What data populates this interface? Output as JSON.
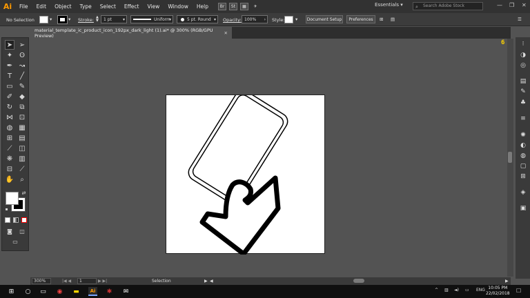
{
  "app": {
    "logo": "Ai",
    "brand_color": "#ff9a00"
  },
  "menu": [
    "File",
    "Edit",
    "Object",
    "Type",
    "Select",
    "Effect",
    "View",
    "Window",
    "Help"
  ],
  "menu_icons": [
    "Br",
    "St",
    "▦",
    "✈"
  ],
  "workspace": "Essentials",
  "stock_search_placeholder": "Search Adobe Stock",
  "window_controls": {
    "minimize": "—",
    "restore": "❐",
    "close": "✕"
  },
  "control_bar": {
    "selection": "No Selection",
    "stroke_label": "Stroke:",
    "stroke_value": "1 pt",
    "profile": "Uniform",
    "brush": "5 pt. Round",
    "opacity_label": "Opacity:",
    "opacity_value": "100%",
    "style_label": "Style:",
    "document_setup": "Document Setup",
    "preferences": "Preferences"
  },
  "document_tab": {
    "title": "material_template_ic_product_icon_192px_dark_light (1).ai* @ 300% (RGB/GPU Preview)",
    "close": "✕"
  },
  "ruler_indicator": "6",
  "status_bar": {
    "zoom": "300%",
    "artboard": "1",
    "tool": "Selection"
  },
  "taskbar": {
    "time": "10:05 PM",
    "date": "22/02/2018",
    "lang": "ENG"
  }
}
